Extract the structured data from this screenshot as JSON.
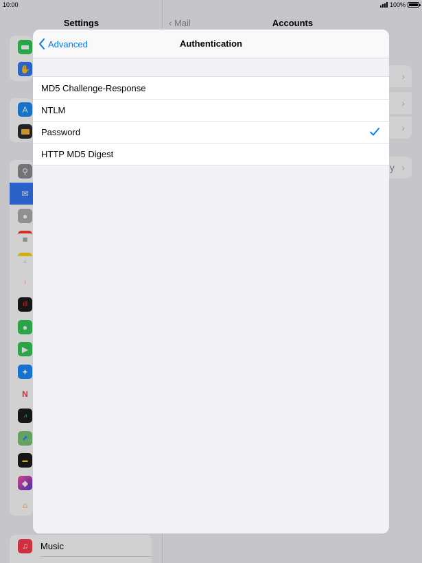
{
  "status_bar": {
    "time": "10:00",
    "battery_text": "100%"
  },
  "background": {
    "left_title": "Settings",
    "right_back": "Mail",
    "right_title": "Accounts",
    "music_label": "Music",
    "right_partial_text": "y"
  },
  "modal": {
    "back_label": "Advanced",
    "title": "Authentication",
    "options": [
      {
        "label": "MD5 Challenge-Response",
        "selected": false
      },
      {
        "label": "NTLM",
        "selected": false
      },
      {
        "label": "Password",
        "selected": true
      },
      {
        "label": "HTTP MD5 Digest",
        "selected": false
      }
    ]
  },
  "colors": {
    "accent": "#007aff",
    "selected_row": "#3478f6"
  },
  "icons": [
    {
      "name": "battery-app-icon",
      "color": "#34c759"
    },
    {
      "name": "hand-privacy-icon",
      "color": "#3478f6"
    },
    {
      "name": "app-store-icon",
      "color": "#1f8bf5"
    },
    {
      "name": "wallet-icon",
      "color": "#2b2b2b"
    },
    {
      "name": "passwords-key-icon",
      "color": "#8e8e93"
    },
    {
      "name": "mail-icon",
      "color": "#3478f6"
    },
    {
      "name": "contacts-icon",
      "color": "#b0b0b4"
    },
    {
      "name": "calendar-icon",
      "color": "#ffffff"
    },
    {
      "name": "notes-icon",
      "color": "#ffd60a"
    },
    {
      "name": "reminders-icon",
      "color": "#ffffff"
    },
    {
      "name": "voice-memos-icon",
      "color": "#1c1c1e"
    },
    {
      "name": "messages-icon",
      "color": "#34c759"
    },
    {
      "name": "facetime-icon",
      "color": "#34c759"
    },
    {
      "name": "safari-icon",
      "color": "#1a8cff"
    },
    {
      "name": "news-icon",
      "color": "#ffffff"
    },
    {
      "name": "stocks-icon",
      "color": "#1c1c1e"
    },
    {
      "name": "maps-icon",
      "color": "#7cc576"
    },
    {
      "name": "measure-icon",
      "color": "#1c1c1e"
    },
    {
      "name": "shortcuts-icon",
      "color": "#5b3ad1"
    },
    {
      "name": "home-icon",
      "color": "#ffffff"
    },
    {
      "name": "music-icon",
      "color": "#fa3c4c"
    }
  ]
}
